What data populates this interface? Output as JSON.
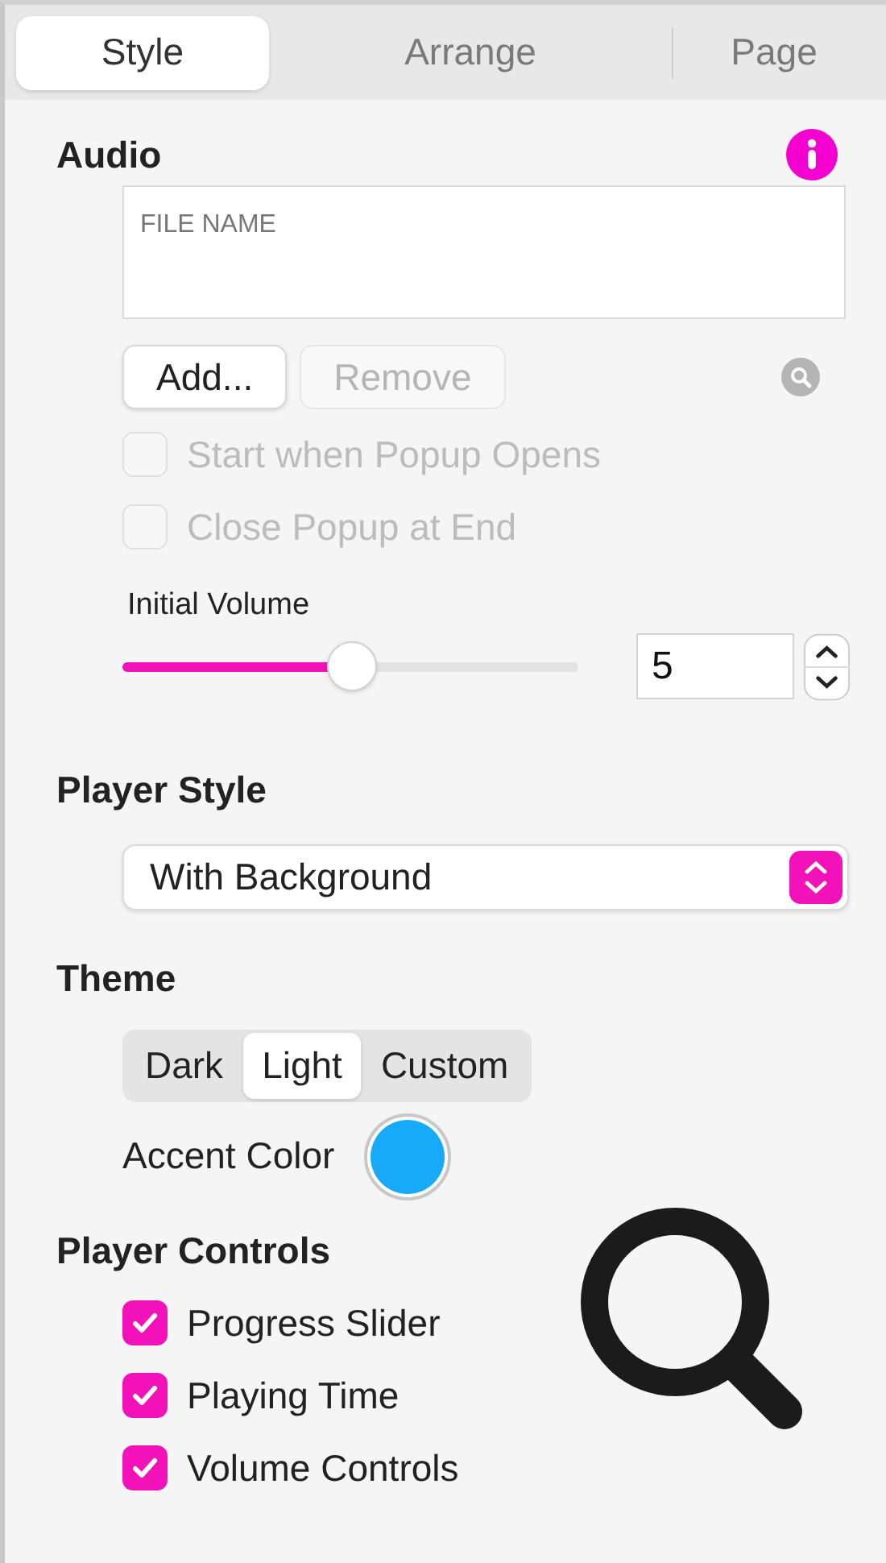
{
  "tabs": [
    {
      "label": "Style",
      "selected": true
    },
    {
      "label": "Arrange",
      "selected": false
    },
    {
      "label": "Page",
      "selected": false
    }
  ],
  "audio": {
    "heading": "Audio",
    "file_list": {
      "placeholder": "FILE NAME"
    },
    "buttons": [
      {
        "label": "Add...",
        "disabled": false
      },
      {
        "label": "Remove",
        "disabled": true
      }
    ],
    "options": [
      {
        "label": "Start when Popup Opens",
        "checked": false,
        "disabled": true
      },
      {
        "label": "Close Popup at End",
        "checked": false,
        "disabled": true
      }
    ],
    "initial_volume": {
      "label": "Initial Volume",
      "level": 0.5,
      "value": "5"
    }
  },
  "player_style": {
    "heading": "Player Style",
    "value": "With Background"
  },
  "theme": {
    "heading": "Theme",
    "options": [
      {
        "label": "Dark",
        "selected": false
      },
      {
        "label": "Light",
        "selected": true
      },
      {
        "label": "Custom",
        "selected": false
      }
    ],
    "accent": {
      "label": "Accent Color",
      "color": "#16aaf8"
    }
  },
  "player_controls": {
    "heading": "Player Controls",
    "items": [
      {
        "label": "Progress Slider",
        "checked": true
      },
      {
        "label": "Playing Time",
        "checked": true
      },
      {
        "label": "Volume Controls",
        "checked": true
      }
    ]
  }
}
